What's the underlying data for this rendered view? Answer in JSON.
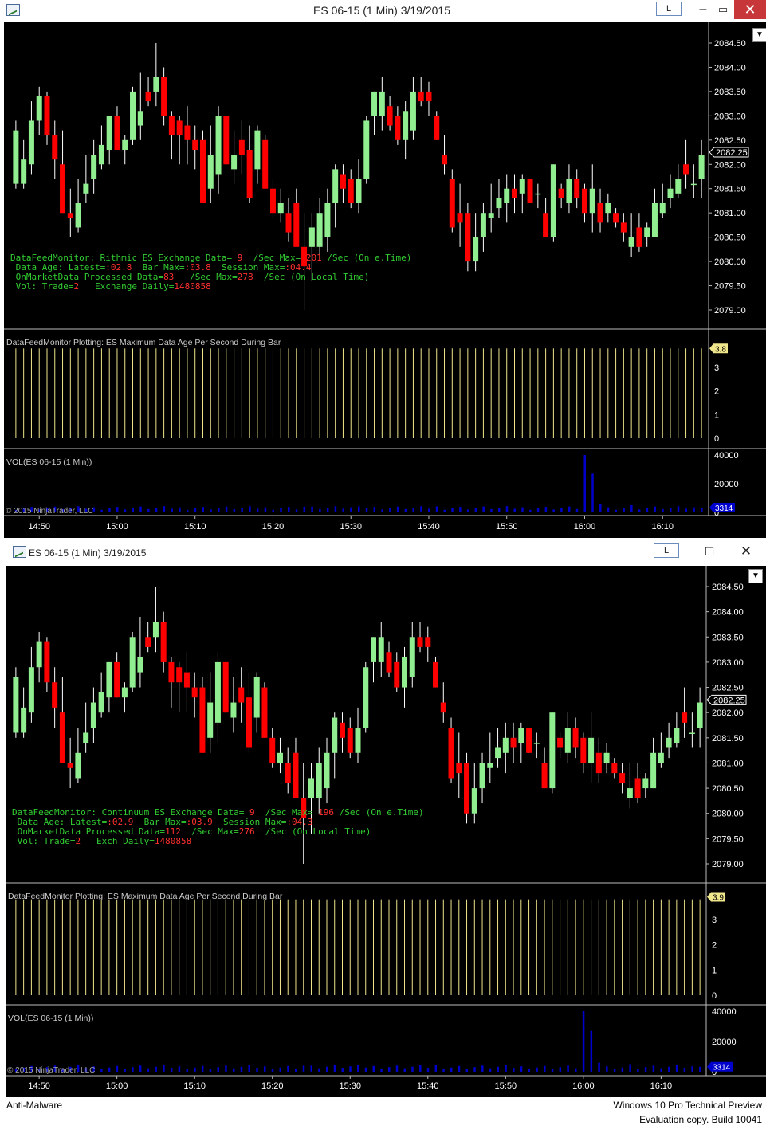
{
  "windows": [
    {
      "title": "ES 06-15 (1 Min)  3/19/2015",
      "link_button": "L",
      "price_labels": [
        "2084.50",
        "2084.00",
        "2083.50",
        "2083.00",
        "2082.50",
        "2082.00",
        "2081.50",
        "2081.00",
        "2080.50",
        "2080.00",
        "2079.50",
        "2079.00"
      ],
      "current_price": "2082.25",
      "monitor_text": {
        "line1_a": "DataFeedMonitor: Rithmic ES Exchange Data= ",
        "line1_b": "9",
        "line1_c": "  /Sec Max= ",
        "line1_d": "201",
        "line1_e": " /Sec (On e.Time)",
        "line2_a": " Data Age: Latest=",
        "line2_b": ":02.8",
        "line2_c": "  Bar Max=",
        "line2_d": ":03.8",
        "line2_e": "  Session Max=",
        "line2_f": ":04.4",
        "line3_a": " OnMarketData Processed Data=",
        "line3_b": "83",
        "line3_c": "   /Sec Max=",
        "line3_d": "278",
        "line3_e": "  /Sec (On Local Time)",
        "line4_a": " Vol: Trade=",
        "line4_b": "2",
        "line4_c": "   Exchange Daily=",
        "line4_d": "1480858"
      },
      "age_panel_label": "DataFeedMonitor Plotting: ES Maximum Data Age Per Second During Bar",
      "age_value": "3.8",
      "age_ticks": [
        "3",
        "2",
        "1",
        "0"
      ],
      "vol_panel_label": "VOL(ES 06-15 (1 Min))",
      "vol_ticks": [
        "40000",
        "20000",
        "0"
      ],
      "vol_value": "3314",
      "copyright": "© 2015 NinjaTrader, LLC",
      "time_labels": [
        "14:50",
        "15:00",
        "15:10",
        "15:20",
        "15:30",
        "15:40",
        "15:50",
        "16:00",
        "16:10"
      ]
    },
    {
      "title": "ES 06-15 (1 Min)  3/19/2015",
      "link_button": "L",
      "price_labels": [
        "2084.50",
        "2084.00",
        "2083.50",
        "2083.00",
        "2082.50",
        "2082.00",
        "2081.50",
        "2081.00",
        "2080.50",
        "2080.00",
        "2079.50",
        "2079.00"
      ],
      "current_price": "2082.25",
      "monitor_text": {
        "line1_a": "DataFeedMonitor: Continuum ES Exchange Data= ",
        "line1_b": "9",
        "line1_c": "  /Sec Max= ",
        "line1_d": "196",
        "line1_e": " /Sec (On e.Time)",
        "line2_a": " Data Age: Latest=",
        "line2_b": ":02.9",
        "line2_c": "  Bar Max=",
        "line2_d": ":03.9",
        "line2_e": "  Session Max=",
        "line2_f": ":04.3",
        "line3_a": " OnMarketData Processed Data=",
        "line3_b": "112",
        "line3_c": "  /Sec Max=",
        "line3_d": "276",
        "line3_e": "  /Sec (On Local Time)",
        "line4_a": " Vol: Trade=",
        "line4_b": "2",
        "line4_c": "   Exch Daily=",
        "line4_d": "1480858"
      },
      "age_panel_label": "DataFeedMonitor Plotting: ES Maximum Data Age Per Second During Bar",
      "age_value": "3.9",
      "age_ticks": [
        "3",
        "2",
        "1",
        "0"
      ],
      "vol_panel_label": "VOL(ES 06-15 (1 Min))",
      "vol_ticks": [
        "40000",
        "20000",
        "0"
      ],
      "vol_value": "3314",
      "copyright": "© 2015 NinjaTrader, LLC",
      "time_labels": [
        "14:50",
        "15:00",
        "15:10",
        "15:20",
        "15:30",
        "15:40",
        "15:50",
        "16:00",
        "16:10"
      ]
    }
  ],
  "taskbar": {
    "left_text": "Anti-Malware",
    "right_line1": "Windows 10 Pro Technical Preview",
    "right_line2": "Evaluation copy. Build 10041"
  },
  "colors": {
    "up": "#90ee90",
    "down": "#ff0000",
    "volume": "#0000cd",
    "age": "#f0e68c",
    "text_green": "#32cd32",
    "text_red": "#ff3030"
  },
  "chart_data": {
    "type": "candlestick",
    "title": "ES 06-15 (1 Min)  3/19/2015",
    "x_range": [
      "14:47",
      "16:15"
    ],
    "y_range": [
      2078.75,
      2084.75
    ],
    "bars": [
      {
        "o": 2081.6,
        "h": 2082.9,
        "l": 2081.5,
        "c": 2082.7
      },
      {
        "o": 2081.6,
        "h": 2082.5,
        "l": 2081.5,
        "c": 2082.1
      },
      {
        "o": 2082.0,
        "h": 2083.3,
        "l": 2081.8,
        "c": 2082.9
      },
      {
        "o": 2082.9,
        "h": 2083.6,
        "l": 2082.6,
        "c": 2083.4
      },
      {
        "o": 2083.4,
        "h": 2083.5,
        "l": 2082.4,
        "c": 2082.6
      },
      {
        "o": 2082.6,
        "h": 2082.9,
        "l": 2081.7,
        "c": 2082.1
      },
      {
        "o": 2082.0,
        "h": 2082.7,
        "l": 2081.0,
        "c": 2081.0
      },
      {
        "o": 2081.0,
        "h": 2081.5,
        "l": 2080.5,
        "c": 2080.9
      },
      {
        "o": 2080.7,
        "h": 2081.7,
        "l": 2080.6,
        "c": 2081.2
      },
      {
        "o": 2081.4,
        "h": 2082.2,
        "l": 2081.2,
        "c": 2081.6
      },
      {
        "o": 2081.7,
        "h": 2082.5,
        "l": 2081.4,
        "c": 2082.2
      },
      {
        "o": 2082.0,
        "h": 2082.8,
        "l": 2081.9,
        "c": 2082.4
      },
      {
        "o": 2082.3,
        "h": 2083.0,
        "l": 2082.0,
        "c": 2083.0
      },
      {
        "o": 2083.0,
        "h": 2083.2,
        "l": 2082.3,
        "c": 2082.3
      },
      {
        "o": 2082.3,
        "h": 2082.6,
        "l": 2082.0,
        "c": 2082.5
      },
      {
        "o": 2082.5,
        "h": 2083.6,
        "l": 2082.4,
        "c": 2083.5
      },
      {
        "o": 2082.8,
        "h": 2083.9,
        "l": 2082.5,
        "c": 2083.1
      },
      {
        "o": 2083.5,
        "h": 2083.8,
        "l": 2083.2,
        "c": 2083.3
      },
      {
        "o": 2083.5,
        "h": 2084.5,
        "l": 2083.2,
        "c": 2083.8
      },
      {
        "o": 2083.8,
        "h": 2084.0,
        "l": 2082.8,
        "c": 2083.0
      },
      {
        "o": 2083.0,
        "h": 2083.1,
        "l": 2082.1,
        "c": 2082.6
      },
      {
        "o": 2082.9,
        "h": 2083.0,
        "l": 2082.0,
        "c": 2082.6
      },
      {
        "o": 2082.8,
        "h": 2083.2,
        "l": 2082.0,
        "c": 2082.5
      },
      {
        "o": 2082.5,
        "h": 2082.8,
        "l": 2081.9,
        "c": 2082.3
      },
      {
        "o": 2082.5,
        "h": 2082.7,
        "l": 2081.2,
        "c": 2081.2
      },
      {
        "o": 2081.5,
        "h": 2082.8,
        "l": 2081.2,
        "c": 2082.2
      },
      {
        "o": 2081.8,
        "h": 2083.2,
        "l": 2081.4,
        "c": 2083.0
      },
      {
        "o": 2083.0,
        "h": 2083.0,
        "l": 2082.0,
        "c": 2082.0
      },
      {
        "o": 2081.9,
        "h": 2082.7,
        "l": 2081.6,
        "c": 2082.2
      },
      {
        "o": 2082.5,
        "h": 2082.9,
        "l": 2081.8,
        "c": 2082.2
      },
      {
        "o": 2082.3,
        "h": 2082.8,
        "l": 2081.2,
        "c": 2081.3
      },
      {
        "o": 2081.9,
        "h": 2082.8,
        "l": 2081.6,
        "c": 2082.7
      },
      {
        "o": 2082.5,
        "h": 2082.6,
        "l": 2081.5,
        "c": 2081.5
      },
      {
        "o": 2081.5,
        "h": 2081.7,
        "l": 2080.9,
        "c": 2081.0
      },
      {
        "o": 2081.0,
        "h": 2081.5,
        "l": 2080.8,
        "c": 2081.2
      },
      {
        "o": 2081.0,
        "h": 2081.3,
        "l": 2080.4,
        "c": 2080.6
      },
      {
        "o": 2081.2,
        "h": 2081.5,
        "l": 2080.5,
        "c": 2080.3
      },
      {
        "o": 2080.3,
        "h": 2081.0,
        "l": 2079.0,
        "c": 2079.9
      },
      {
        "o": 2080.3,
        "h": 2081.0,
        "l": 2079.6,
        "c": 2080.7
      },
      {
        "o": 2080.3,
        "h": 2081.3,
        "l": 2080.0,
        "c": 2081.0
      },
      {
        "o": 2080.5,
        "h": 2081.5,
        "l": 2080.2,
        "c": 2081.2
      },
      {
        "o": 2081.2,
        "h": 2082.0,
        "l": 2080.7,
        "c": 2081.9
      },
      {
        "o": 2081.8,
        "h": 2082.0,
        "l": 2081.2,
        "c": 2081.5
      },
      {
        "o": 2081.7,
        "h": 2081.9,
        "l": 2081.1,
        "c": 2081.2
      },
      {
        "o": 2081.2,
        "h": 2082.1,
        "l": 2081.0,
        "c": 2081.7
      },
      {
        "o": 2081.7,
        "h": 2083.0,
        "l": 2081.6,
        "c": 2082.9
      },
      {
        "o": 2083.0,
        "h": 2083.5,
        "l": 2082.6,
        "c": 2083.5
      },
      {
        "o": 2083.0,
        "h": 2083.8,
        "l": 2082.7,
        "c": 2083.5
      },
      {
        "o": 2083.2,
        "h": 2083.4,
        "l": 2082.7,
        "c": 2082.8
      },
      {
        "o": 2083.0,
        "h": 2083.2,
        "l": 2082.4,
        "c": 2082.5
      },
      {
        "o": 2082.5,
        "h": 2083.3,
        "l": 2082.1,
        "c": 2083.1
      },
      {
        "o": 2082.7,
        "h": 2083.8,
        "l": 2082.5,
        "c": 2083.5
      },
      {
        "o": 2083.5,
        "h": 2083.8,
        "l": 2083.2,
        "c": 2083.3
      },
      {
        "o": 2083.5,
        "h": 2083.7,
        "l": 2083.0,
        "c": 2083.3
      },
      {
        "o": 2083.0,
        "h": 2083.1,
        "l": 2082.5,
        "c": 2082.5
      },
      {
        "o": 2082.2,
        "h": 2082.6,
        "l": 2081.8,
        "c": 2082.0
      },
      {
        "o": 2081.7,
        "h": 2081.9,
        "l": 2080.6,
        "c": 2080.7
      },
      {
        "o": 2081.0,
        "h": 2081.6,
        "l": 2080.3,
        "c": 2080.8
      },
      {
        "o": 2081.0,
        "h": 2081.2,
        "l": 2079.8,
        "c": 2080.0
      },
      {
        "o": 2080.0,
        "h": 2081.0,
        "l": 2079.8,
        "c": 2080.5
      },
      {
        "o": 2080.5,
        "h": 2081.2,
        "l": 2080.2,
        "c": 2081.0
      },
      {
        "o": 2080.9,
        "h": 2081.6,
        "l": 2080.6,
        "c": 2081.0
      },
      {
        "o": 2081.1,
        "h": 2081.7,
        "l": 2080.9,
        "c": 2081.3
      },
      {
        "o": 2081.2,
        "h": 2081.8,
        "l": 2080.8,
        "c": 2081.5
      },
      {
        "o": 2081.5,
        "h": 2081.8,
        "l": 2081.0,
        "c": 2081.3
      },
      {
        "o": 2081.4,
        "h": 2081.8,
        "l": 2081.0,
        "c": 2081.7
      },
      {
        "o": 2081.7,
        "h": 2081.7,
        "l": 2081.2,
        "c": 2081.2
      },
      {
        "o": 2081.4,
        "h": 2081.6,
        "l": 2081.1,
        "c": 2081.4
      },
      {
        "o": 2081.0,
        "h": 2081.3,
        "l": 2080.5,
        "c": 2080.5
      },
      {
        "o": 2080.5,
        "h": 2082.0,
        "l": 2080.4,
        "c": 2082.0
      },
      {
        "o": 2081.5,
        "h": 2081.6,
        "l": 2081.1,
        "c": 2081.3
      },
      {
        "o": 2081.2,
        "h": 2082.0,
        "l": 2081.0,
        "c": 2081.7
      },
      {
        "o": 2081.7,
        "h": 2081.9,
        "l": 2081.1,
        "c": 2081.3
      },
      {
        "o": 2081.5,
        "h": 2081.6,
        "l": 2080.8,
        "c": 2081.0
      },
      {
        "o": 2081.0,
        "h": 2082.0,
        "l": 2080.6,
        "c": 2081.5
      },
      {
        "o": 2081.2,
        "h": 2081.5,
        "l": 2080.6,
        "c": 2080.8
      },
      {
        "o": 2081.0,
        "h": 2081.4,
        "l": 2080.8,
        "c": 2081.2
      },
      {
        "o": 2081.0,
        "h": 2081.1,
        "l": 2080.7,
        "c": 2080.8
      },
      {
        "o": 2080.8,
        "h": 2081.0,
        "l": 2080.4,
        "c": 2080.6
      },
      {
        "o": 2080.3,
        "h": 2081.0,
        "l": 2080.1,
        "c": 2080.5
      },
      {
        "o": 2080.7,
        "h": 2081.0,
        "l": 2080.2,
        "c": 2080.3
      },
      {
        "o": 2080.5,
        "h": 2080.8,
        "l": 2080.3,
        "c": 2080.7
      },
      {
        "o": 2080.5,
        "h": 2081.5,
        "l": 2080.5,
        "c": 2081.2
      },
      {
        "o": 2081.0,
        "h": 2081.6,
        "l": 2080.9,
        "c": 2081.2
      },
      {
        "o": 2081.3,
        "h": 2081.8,
        "l": 2081.1,
        "c": 2081.5
      },
      {
        "o": 2081.4,
        "h": 2082.0,
        "l": 2081.3,
        "c": 2081.7
      },
      {
        "o": 2082.0,
        "h": 2082.5,
        "l": 2081.5,
        "c": 2081.8
      },
      {
        "o": 2081.6,
        "h": 2082.0,
        "l": 2081.3,
        "c": 2081.6
      },
      {
        "o": 2081.7,
        "h": 2082.5,
        "l": 2081.3,
        "c": 2082.2
      }
    ],
    "age_series": {
      "name": "DataFeedMonitor Plotting: ES Maximum Data Age Per Second During Bar",
      "y_range": [
        0,
        4
      ],
      "typical": 3.8
    },
    "volume": {
      "name": "VOL(ES 06-15 (1 Min))",
      "y_range": [
        0,
        42000
      ],
      "spikes": [
        {
          "time": "16:00",
          "value": 40000
        },
        {
          "time": "16:01",
          "value": 27000
        },
        {
          "time": "16:02",
          "value": 6000
        }
      ],
      "typical": 1800,
      "last": 3314
    }
  }
}
